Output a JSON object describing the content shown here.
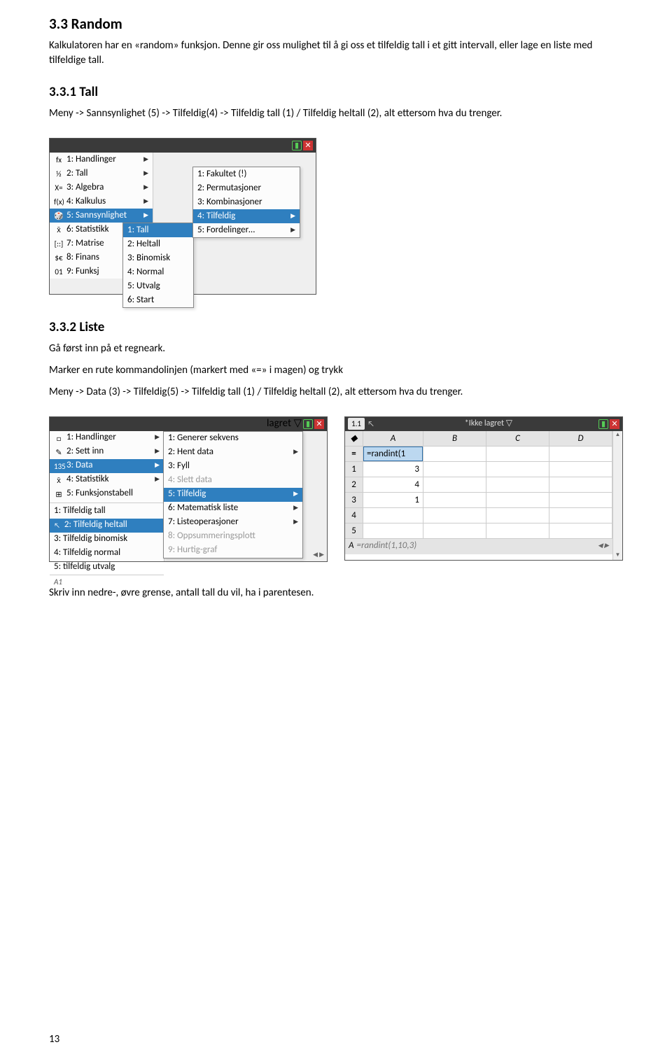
{
  "s33": {
    "heading": "3.3   Random",
    "p1": "Kalkulatoren har en «random» funksjon. Denne gir oss mulighet til å gi oss et tilfeldig tall i et gitt intervall, eller lage en liste med tilfeldige tall."
  },
  "s331": {
    "heading": "3.3.1   Tall",
    "p1": "Meny -> Sannsynlighet (5) -> Tilfeldig(4) -> Tilfeldig tall (1) / Tilfeldig heltall (2), alt ettersom hva du trenger."
  },
  "shot1": {
    "m1": [
      {
        "ico": "fx",
        "txt": "1: Handlinger"
      },
      {
        "ico": "½",
        "txt": "2: Tall"
      },
      {
        "ico": "X=",
        "txt": "3: Algebra"
      },
      {
        "ico": "f(x)",
        "txt": "4: Kalkulus"
      },
      {
        "ico": "🎲",
        "txt": "5: Sannsynlighet",
        "sel": true
      },
      {
        "ico": "x̄",
        "txt": "6: Statistikk"
      },
      {
        "ico": "[::]",
        "txt": "7: Matrise"
      },
      {
        "ico": "$€",
        "txt": "8: Finans"
      },
      {
        "ico": "01",
        "txt": "9: Funksj"
      }
    ],
    "m2": [
      {
        "txt": "1: Tall",
        "sel": true
      },
      {
        "txt": "2: Heltall"
      },
      {
        "txt": "3: Binomisk"
      },
      {
        "txt": "4: Normal"
      },
      {
        "txt": "5: Utvalg"
      },
      {
        "txt": "6: Start"
      }
    ],
    "m3": [
      {
        "txt": "1: Fakultet (!)"
      },
      {
        "txt": "2: Permutasjoner"
      },
      {
        "txt": "3: Kombinasjoner"
      },
      {
        "txt": "4: Tilfeldig",
        "sel": true,
        "arrow": true
      },
      {
        "txt": "5: Fordelinger…",
        "arrow": true
      }
    ]
  },
  "s332": {
    "heading": "3.3.2   Liste",
    "p1": "Gå først inn på et regneark.",
    "p2": "Marker en rute kommandolinjen (markert med «=» i magen) og trykk",
    "p3": "Meny -> Data (3) -> Tilfeldig(5) -> Tilfeldig tall (1) / Tilfeldig heltall (2), alt ettersom hva du trenger."
  },
  "shot2": {
    "tbtext": "lagret ▽",
    "m1": [
      {
        "ico": "□",
        "txt": "1: Handlinger"
      },
      {
        "ico": "✎",
        "txt": "2: Sett inn"
      },
      {
        "ico": "135",
        "txt": "3: Data",
        "sel": true
      },
      {
        "ico": "x̄",
        "txt": "4: Statistikk"
      },
      {
        "ico": "⊞",
        "txt": "5: Funksjonstabell"
      }
    ],
    "m1b": [
      {
        "txt": "1: Tilfeldig tall"
      },
      {
        "txt": "2: Tilfeldig heltall",
        "sel": true
      },
      {
        "txt": "3: Tilfeldig binomisk"
      },
      {
        "txt": "4: Tilfeldig normal"
      },
      {
        "txt": "5: tilfeldig utvalg"
      }
    ],
    "cellA1": "A1",
    "m2": [
      {
        "txt": "1: Generer sekvens"
      },
      {
        "txt": "2: Hent data",
        "arrow": true
      },
      {
        "txt": "3: Fyll"
      },
      {
        "txt": "4: Slett data",
        "dim": true
      },
      {
        "txt": "5: Tilfeldig",
        "sel": true,
        "arrow": true
      },
      {
        "txt": "6: Matematisk liste",
        "arrow": true
      },
      {
        "txt": "7: Listeoperasjoner",
        "arrow": true
      },
      {
        "txt": "8: Oppsummeringsplott",
        "dim": true
      },
      {
        "txt": "9: Hurtig-graf",
        "dim": true
      }
    ]
  },
  "shot3": {
    "tab": "1.1",
    "titletext": "*Ikke lagret ▽",
    "cols": [
      "A",
      "B",
      "C",
      "D"
    ],
    "eqcell": "=randint(1",
    "rows": [
      {
        "n": "1",
        "v": "3"
      },
      {
        "n": "2",
        "v": "4"
      },
      {
        "n": "3",
        "v": "1"
      },
      {
        "n": "4",
        "v": ""
      },
      {
        "n": "5",
        "v": ""
      }
    ],
    "formula_lhs": "A",
    "formula": "=randint(1,10,3)"
  },
  "footer": {
    "p": "Skriv inn nedre-, øvre grense, antall tall du vil, ha i parentesen.",
    "pagenum": "13"
  }
}
